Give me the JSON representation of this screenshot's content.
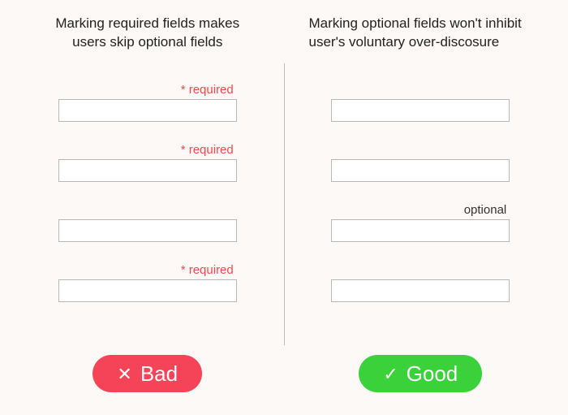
{
  "left": {
    "caption": "Marking required fields makes users skip optional fields",
    "fields": [
      {
        "label": "* required",
        "kind": "required"
      },
      {
        "label": "* required",
        "kind": "required"
      },
      {
        "label": "",
        "kind": "empty"
      },
      {
        "label": "* required",
        "kind": "required"
      }
    ],
    "badge_mark": "✕",
    "badge_text": "Bad"
  },
  "right": {
    "caption": "Marking optional fields won't inhibit user's voluntary over-discosure",
    "fields": [
      {
        "label": "",
        "kind": "empty"
      },
      {
        "label": "",
        "kind": "empty"
      },
      {
        "label": "optional",
        "kind": "optional"
      },
      {
        "label": "",
        "kind": "empty"
      }
    ],
    "badge_mark": "✓",
    "badge_text": "Good"
  }
}
